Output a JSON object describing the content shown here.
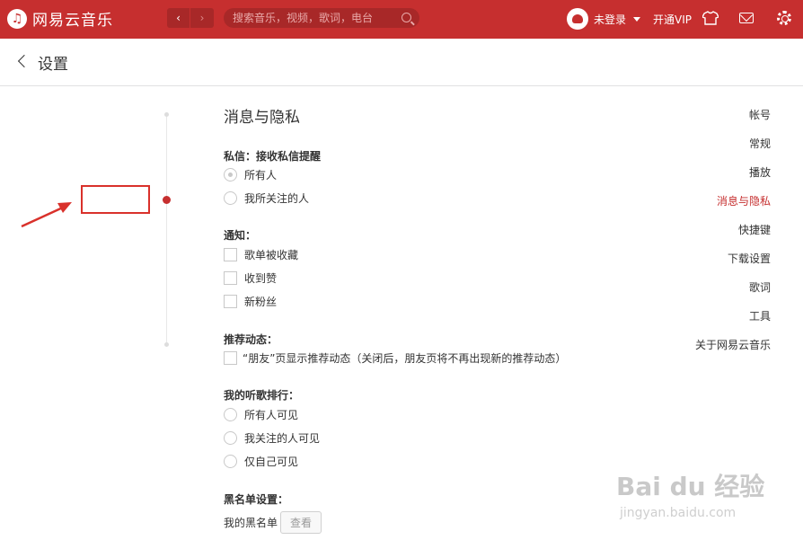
{
  "app": {
    "logo_text": "网易云音乐",
    "search_placeholder": "搜索音乐，视频，歌词，电台",
    "username": "未登录",
    "vip_label": "开通VIP"
  },
  "header": {
    "title": "设置"
  },
  "menu": {
    "items": [
      "帐号",
      "常规",
      "播放",
      "消息与隐私",
      "快捷键",
      "下载设置",
      "歌词",
      "工具",
      "关于网易云音乐"
    ],
    "active": "消息与隐私"
  },
  "content": {
    "section_title": "消息与隐私",
    "private_msg": {
      "title": "私信：接收私信提醒",
      "options": [
        "所有人",
        "我所关注的人"
      ],
      "selected": "所有人"
    },
    "notify": {
      "title": "通知：",
      "options": [
        "歌单被收藏",
        "收到赞",
        "新粉丝"
      ]
    },
    "recommend": {
      "title": "推荐动态：",
      "option": "“朋友”页显示推荐动态（关闭后，朋友页将不再出现新的推荐动态）"
    },
    "ranking": {
      "title": "我的听歌排行：",
      "options": [
        "所有人可见",
        "我关注的人可见",
        "仅自己可见"
      ]
    },
    "blacklist": {
      "title": "黑名单设置：",
      "label": "我的黑名单",
      "button": "查看"
    }
  },
  "watermark": {
    "main": "Bai du 经验",
    "sub": "jingyan.baidu.com"
  },
  "colors": {
    "brand": "#c62f2f",
    "highlight_box": "#d9312b"
  }
}
